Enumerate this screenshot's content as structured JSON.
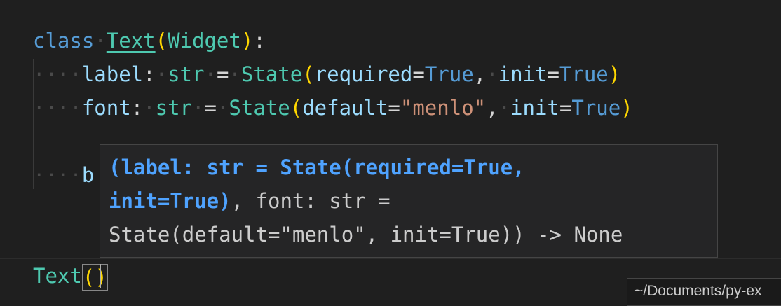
{
  "code": {
    "line1": {
      "kw": "class",
      "name": "Text",
      "open": "(",
      "base": "Widget",
      "close": ")",
      "colon": ":"
    },
    "line2": {
      "field": "label",
      "colon": ":",
      "type": "str",
      "eq": "=",
      "call": "State",
      "open": "(",
      "arg1": "required",
      "eq1": "=",
      "val1": "True",
      "comma": ",",
      "arg2": "init",
      "eq2": "=",
      "val2": "True",
      "close": ")"
    },
    "line3": {
      "field": "font",
      "colon": ":",
      "type": "str",
      "eq": "=",
      "call": "State",
      "open": "(",
      "arg1": "default",
      "eq1": "=",
      "val1": "\"menlo\"",
      "comma": ",",
      "arg2": "init",
      "eq2": "=",
      "val2": "True",
      "close": ")"
    },
    "line5": {
      "partial": "b"
    },
    "line7": {
      "call": "Text",
      "open": "(",
      "close": ")"
    }
  },
  "hover": {
    "line1_active": "(label: str = State(required=True,",
    "line2_active": "init=True)",
    "line2_rest": ", font: str =",
    "line3": "State(default=\"menlo\", init=True)) -> None"
  },
  "status": {
    "path": "~/Documents/py-ex"
  },
  "colors": {
    "background": "#1f1f1f",
    "keyword": "#569cd6",
    "class": "#4ec9b0",
    "string": "#ce9178",
    "variable": "#9cdcfe",
    "bracket": "#ffd700",
    "active_param": "#4fa3ff"
  }
}
